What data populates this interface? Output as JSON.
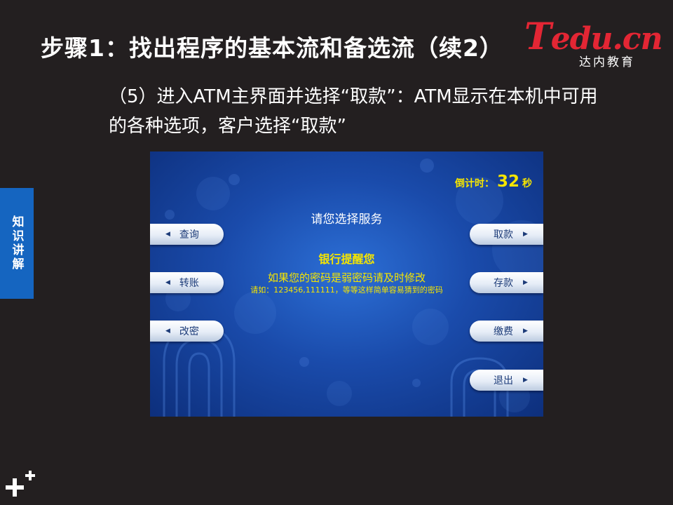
{
  "slide": {
    "title": "步骤1：找出程序的基本流和备选流（续2）",
    "description": "（5）进入ATM主界面并选择“取款”：ATM显示在本机中可用的各种选项，客户选择“取款”",
    "side_tab": "知识讲解"
  },
  "logo": {
    "brand_t": "T",
    "brand_rest": "edu.cn",
    "subtitle": "达内教育"
  },
  "atm": {
    "countdown_label": "倒计时：",
    "countdown_value": "32",
    "countdown_unit": "秒",
    "prompt": "请您选择服务",
    "notice_title": "银行提醒您",
    "notice_main": "如果您的密码是弱密码请及时修改",
    "notice_detail": "请如：123456,111111，等等这样简单容易猜到的密码",
    "left_buttons": [
      {
        "label": "查询",
        "icon": "arrow-left-icon"
      },
      {
        "label": "转账",
        "icon": "arrow-left-icon"
      },
      {
        "label": "改密",
        "icon": "arrow-left-icon"
      }
    ],
    "right_buttons": [
      {
        "label": "取款",
        "icon": "arrow-right-icon"
      },
      {
        "label": "存款",
        "icon": "arrow-right-icon"
      },
      {
        "label": "缴费",
        "icon": "arrow-right-icon"
      },
      {
        "label": "退出",
        "icon": "arrow-right-icon"
      }
    ]
  },
  "colors": {
    "slide_background": "#231f20",
    "side_tab": "#1565c0",
    "logo_red": "#e32634",
    "atm_blue": "#1a4bab",
    "atm_text_yellow": "#f5e500"
  }
}
